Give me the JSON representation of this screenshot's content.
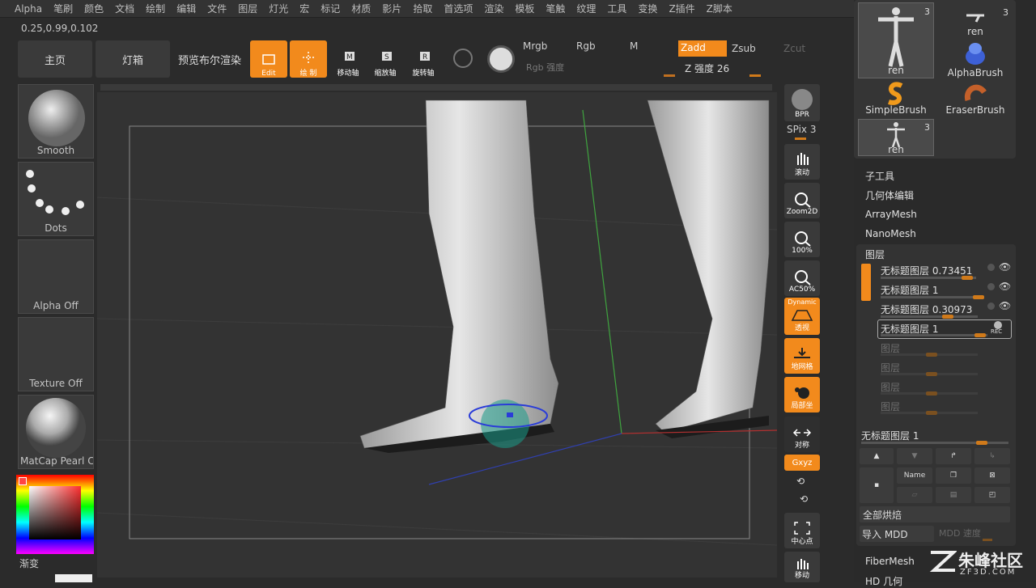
{
  "menu": [
    "Alpha",
    "笔刷",
    "颜色",
    "文档",
    "绘制",
    "编辑",
    "文件",
    "图层",
    "灯光",
    "宏",
    "标记",
    "材质",
    "影片",
    "拾取",
    "首选项",
    "渲染",
    "模板",
    "笔触",
    "纹理",
    "工具",
    "变换",
    "Z插件",
    "Z脚本"
  ],
  "coords": "0.25,0.99,0.102",
  "topbar": {
    "home": "主页",
    "lightbox": "灯箱",
    "bool_preview": "预览布尔渲染",
    "edit": "Edit",
    "draw": "绘 制",
    "move": "移动轴",
    "scale": "缩放轴",
    "rotate": "旋转轴",
    "mrgb": "Mrgb",
    "rgb": "Rgb",
    "m": "M",
    "zadd": "Zadd",
    "zsub": "Zsub",
    "zcut": "Zcut",
    "rgb_intensity": "Rgb 强度",
    "z_intensity": "Z 强度 26"
  },
  "left": {
    "brush": "Smooth",
    "stroke": "Dots",
    "alpha": "Alpha Off",
    "texture": "Texture Off",
    "material": "MatCap Pearl Ca",
    "gradient": "渐变"
  },
  "right_shelf": {
    "bpr": "BPR",
    "spix": "SPix 3",
    "scroll": "滚动",
    "zoom2d": "Zoom2D",
    "hundred": "100%",
    "ac50": "AC50%",
    "persp_top": "Dynamic",
    "persp": "透视",
    "floor": "地网格",
    "local": "局部坐",
    "symmetry": "对称",
    "xyz": "Gxyz",
    "center": "中心点",
    "move_bottom": "移动"
  },
  "toolbox": {
    "ren1": "ren",
    "ren1_count": "3",
    "ren2": "ren",
    "ren2_count": "3",
    "alpha_brush": "AlphaBrush",
    "simple_brush": "SimpleBrush",
    "eraser_brush": "EraserBrush",
    "ren3": "ren",
    "ren3_count": "3"
  },
  "subpalette": [
    "子工具",
    "几何体编辑",
    "ArrayMesh",
    "NanoMesh"
  ],
  "layers": {
    "title": "图层",
    "items": [
      {
        "name": "无标题图层 0.73451"
      },
      {
        "name": "无标题图层 1"
      },
      {
        "name": "无标题图层 0.30973"
      },
      {
        "name": "无标题图层 1"
      }
    ],
    "empty": [
      "图层",
      "图层",
      "图层",
      "图层"
    ],
    "rec": "REC",
    "current": "无标题图层 1",
    "name_btn": "Name",
    "bake_all": "全部烘焙",
    "import_mdd": "导入 MDD",
    "mdd_speed": "MDD 速度"
  },
  "bottom": {
    "fibermesh": "FiberMesh",
    "hd": "HD 几何"
  },
  "watermark": {
    "site": "朱峰社区",
    "url": "ZF3D.COM"
  }
}
